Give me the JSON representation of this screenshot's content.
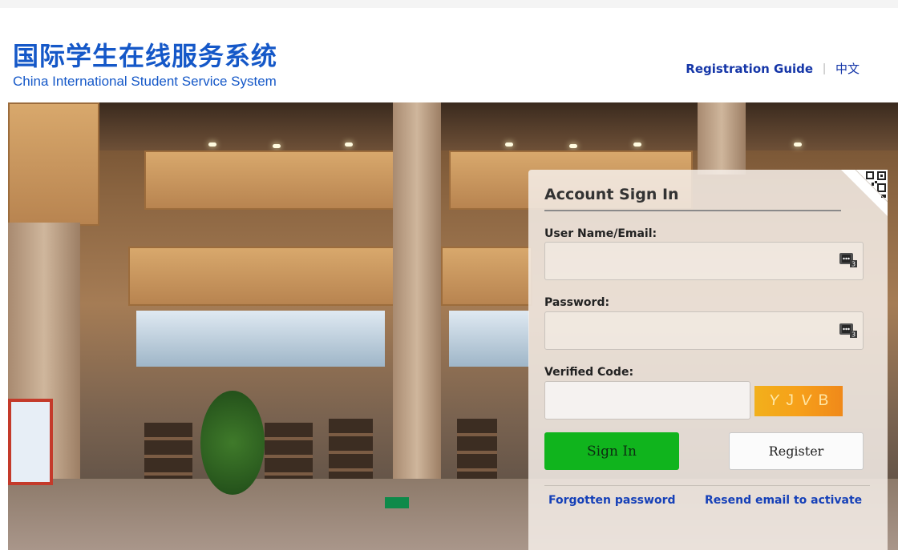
{
  "header": {
    "logo_cn": "国际学生在线服务系统",
    "logo_en": "China International Student Service System",
    "nav": {
      "guide": "Registration Guide",
      "separator": "|",
      "language": "中文"
    }
  },
  "login": {
    "title": "Account Sign In",
    "username_label": "User Name/Email:",
    "password_label": "Password:",
    "code_label": "Verified Code:",
    "username_value": "",
    "password_value": "",
    "code_value": "",
    "captcha": [
      "Y",
      "J",
      "V",
      "B"
    ],
    "password_manager_badge": "3",
    "sign_in": "Sign In",
    "register": "Register",
    "forgot": "Forgotten password",
    "resend": "Resend email to activate"
  },
  "colors": {
    "brand_blue": "#1558c8",
    "link_blue": "#1540b8",
    "signin_green": "#10b41d",
    "captcha_orange": "#f6a01a"
  }
}
